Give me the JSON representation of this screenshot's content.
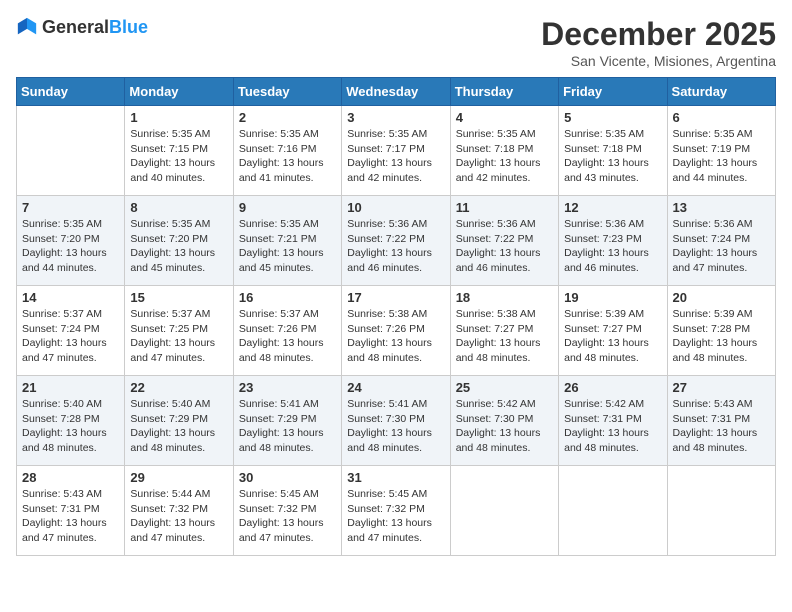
{
  "header": {
    "logo_general": "General",
    "logo_blue": "Blue",
    "month": "December 2025",
    "location": "San Vicente, Misiones, Argentina"
  },
  "days_of_week": [
    "Sunday",
    "Monday",
    "Tuesday",
    "Wednesday",
    "Thursday",
    "Friday",
    "Saturday"
  ],
  "weeks": [
    [
      {
        "day": "",
        "info": ""
      },
      {
        "day": "1",
        "info": "Sunrise: 5:35 AM\nSunset: 7:15 PM\nDaylight: 13 hours\nand 40 minutes."
      },
      {
        "day": "2",
        "info": "Sunrise: 5:35 AM\nSunset: 7:16 PM\nDaylight: 13 hours\nand 41 minutes."
      },
      {
        "day": "3",
        "info": "Sunrise: 5:35 AM\nSunset: 7:17 PM\nDaylight: 13 hours\nand 42 minutes."
      },
      {
        "day": "4",
        "info": "Sunrise: 5:35 AM\nSunset: 7:18 PM\nDaylight: 13 hours\nand 42 minutes."
      },
      {
        "day": "5",
        "info": "Sunrise: 5:35 AM\nSunset: 7:18 PM\nDaylight: 13 hours\nand 43 minutes."
      },
      {
        "day": "6",
        "info": "Sunrise: 5:35 AM\nSunset: 7:19 PM\nDaylight: 13 hours\nand 44 minutes."
      }
    ],
    [
      {
        "day": "7",
        "info": "Sunrise: 5:35 AM\nSunset: 7:20 PM\nDaylight: 13 hours\nand 44 minutes."
      },
      {
        "day": "8",
        "info": "Sunrise: 5:35 AM\nSunset: 7:20 PM\nDaylight: 13 hours\nand 45 minutes."
      },
      {
        "day": "9",
        "info": "Sunrise: 5:35 AM\nSunset: 7:21 PM\nDaylight: 13 hours\nand 45 minutes."
      },
      {
        "day": "10",
        "info": "Sunrise: 5:36 AM\nSunset: 7:22 PM\nDaylight: 13 hours\nand 46 minutes."
      },
      {
        "day": "11",
        "info": "Sunrise: 5:36 AM\nSunset: 7:22 PM\nDaylight: 13 hours\nand 46 minutes."
      },
      {
        "day": "12",
        "info": "Sunrise: 5:36 AM\nSunset: 7:23 PM\nDaylight: 13 hours\nand 46 minutes."
      },
      {
        "day": "13",
        "info": "Sunrise: 5:36 AM\nSunset: 7:24 PM\nDaylight: 13 hours\nand 47 minutes."
      }
    ],
    [
      {
        "day": "14",
        "info": "Sunrise: 5:37 AM\nSunset: 7:24 PM\nDaylight: 13 hours\nand 47 minutes."
      },
      {
        "day": "15",
        "info": "Sunrise: 5:37 AM\nSunset: 7:25 PM\nDaylight: 13 hours\nand 47 minutes."
      },
      {
        "day": "16",
        "info": "Sunrise: 5:37 AM\nSunset: 7:26 PM\nDaylight: 13 hours\nand 48 minutes."
      },
      {
        "day": "17",
        "info": "Sunrise: 5:38 AM\nSunset: 7:26 PM\nDaylight: 13 hours\nand 48 minutes."
      },
      {
        "day": "18",
        "info": "Sunrise: 5:38 AM\nSunset: 7:27 PM\nDaylight: 13 hours\nand 48 minutes."
      },
      {
        "day": "19",
        "info": "Sunrise: 5:39 AM\nSunset: 7:27 PM\nDaylight: 13 hours\nand 48 minutes."
      },
      {
        "day": "20",
        "info": "Sunrise: 5:39 AM\nSunset: 7:28 PM\nDaylight: 13 hours\nand 48 minutes."
      }
    ],
    [
      {
        "day": "21",
        "info": "Sunrise: 5:40 AM\nSunset: 7:28 PM\nDaylight: 13 hours\nand 48 minutes."
      },
      {
        "day": "22",
        "info": "Sunrise: 5:40 AM\nSunset: 7:29 PM\nDaylight: 13 hours\nand 48 minutes."
      },
      {
        "day": "23",
        "info": "Sunrise: 5:41 AM\nSunset: 7:29 PM\nDaylight: 13 hours\nand 48 minutes."
      },
      {
        "day": "24",
        "info": "Sunrise: 5:41 AM\nSunset: 7:30 PM\nDaylight: 13 hours\nand 48 minutes."
      },
      {
        "day": "25",
        "info": "Sunrise: 5:42 AM\nSunset: 7:30 PM\nDaylight: 13 hours\nand 48 minutes."
      },
      {
        "day": "26",
        "info": "Sunrise: 5:42 AM\nSunset: 7:31 PM\nDaylight: 13 hours\nand 48 minutes."
      },
      {
        "day": "27",
        "info": "Sunrise: 5:43 AM\nSunset: 7:31 PM\nDaylight: 13 hours\nand 48 minutes."
      }
    ],
    [
      {
        "day": "28",
        "info": "Sunrise: 5:43 AM\nSunset: 7:31 PM\nDaylight: 13 hours\nand 47 minutes."
      },
      {
        "day": "29",
        "info": "Sunrise: 5:44 AM\nSunset: 7:32 PM\nDaylight: 13 hours\nand 47 minutes."
      },
      {
        "day": "30",
        "info": "Sunrise: 5:45 AM\nSunset: 7:32 PM\nDaylight: 13 hours\nand 47 minutes."
      },
      {
        "day": "31",
        "info": "Sunrise: 5:45 AM\nSunset: 7:32 PM\nDaylight: 13 hours\nand 47 minutes."
      },
      {
        "day": "",
        "info": ""
      },
      {
        "day": "",
        "info": ""
      },
      {
        "day": "",
        "info": ""
      }
    ]
  ]
}
